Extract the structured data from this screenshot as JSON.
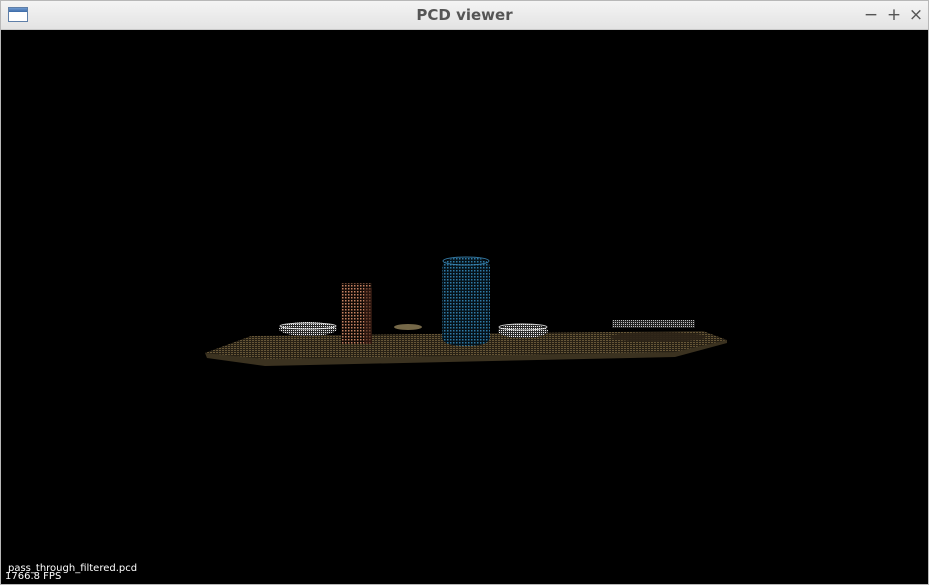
{
  "window": {
    "title": "PCD viewer",
    "controls": {
      "minimize": "−",
      "maximize": "+",
      "close": "×"
    },
    "icon": "window-app-icon"
  },
  "viewer": {
    "background_color": "#000000",
    "file_name": "pass_through_filtered.pcd",
    "fps": "1766.8 FPS",
    "point_cloud": {
      "objects": [
        {
          "name": "table-surface",
          "color": "#6b5a3a"
        },
        {
          "name": "box",
          "color": "#c07a55"
        },
        {
          "name": "cylinder-can",
          "color": "#2e6f95"
        },
        {
          "name": "bowl-left",
          "color": "#e8e8e8"
        },
        {
          "name": "bowl-center",
          "color": "#e8e8e8"
        },
        {
          "name": "plate-right",
          "color": "#cfcfcf"
        },
        {
          "name": "small-object",
          "color": "#8a7a55"
        }
      ]
    }
  }
}
